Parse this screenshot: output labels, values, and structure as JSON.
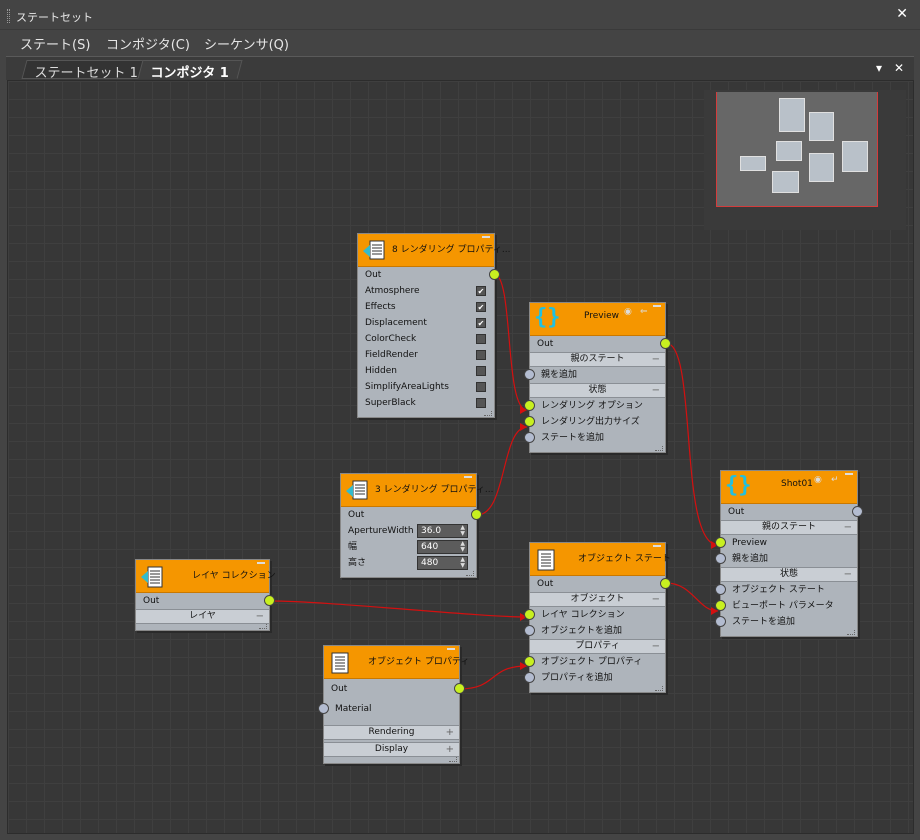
{
  "window": {
    "title": "ステートセット",
    "close": "✕"
  },
  "menu": [
    "ステート(S)",
    "コンポジタ(C)",
    "シーケンサ(Q)"
  ],
  "tabs": [
    "ステートセット 1",
    "コンポジタ 1"
  ],
  "tab_controls": {
    "dropdown": "▾",
    "close": "✕"
  },
  "nodes": {
    "render_props": {
      "title": "8 レンダリング プロパティ...",
      "out": "Out",
      "items": [
        {
          "label": "Atmosphere",
          "checked": true
        },
        {
          "label": "Effects",
          "checked": true
        },
        {
          "label": "Displacement",
          "checked": true
        },
        {
          "label": "ColorCheck",
          "checked": false
        },
        {
          "label": "FieldRender",
          "checked": false
        },
        {
          "label": "Hidden",
          "checked": false
        },
        {
          "label": "SimplifyAreaLights",
          "checked": false
        },
        {
          "label": "SuperBlack",
          "checked": false
        }
      ]
    },
    "render_props3": {
      "title": "3 レンダリング プロパティ...",
      "out": "Out",
      "fields": [
        {
          "label": "ApertureWidth",
          "value": "36.0"
        },
        {
          "label": "幅",
          "value": "640"
        },
        {
          "label": "高さ",
          "value": "480"
        }
      ]
    },
    "preview": {
      "title": "Preview",
      "out": "Out",
      "parent_section": "親のステート",
      "add_parent": "親を追加",
      "state_section": "状態",
      "inputs": [
        "レンダリング オプション",
        "レンダリング出力サイズ",
        "ステートを追加"
      ]
    },
    "layer": {
      "title": "レイヤ コレクション",
      "out": "Out",
      "section": "レイヤ"
    },
    "obj_prop": {
      "title": "オブジェクト プロパティ",
      "out": "Out",
      "material": "Material",
      "sections": [
        "Rendering",
        "Display"
      ]
    },
    "obj_state": {
      "title": "オブジェクト ステート",
      "out": "Out",
      "section1": "オブジェクト",
      "inputs1": [
        "レイヤ コレクション",
        "オブジェクトを追加"
      ],
      "section2": "プロパティ",
      "inputs2": [
        "オブジェクト プロパティ",
        "プロパティを追加"
      ]
    },
    "shot": {
      "title": "Shot01",
      "out": "Out",
      "parent_section": "親のステート",
      "inputs1": [
        "Preview",
        "親を追加"
      ],
      "state_section": "状態",
      "inputs2": [
        "オブジェクト ステート",
        "ビューポート パラメータ",
        "ステートを追加"
      ]
    }
  },
  "colors": {
    "header": "#f59600",
    "socket_on": "#c8f020",
    "wire": "#d41010"
  }
}
